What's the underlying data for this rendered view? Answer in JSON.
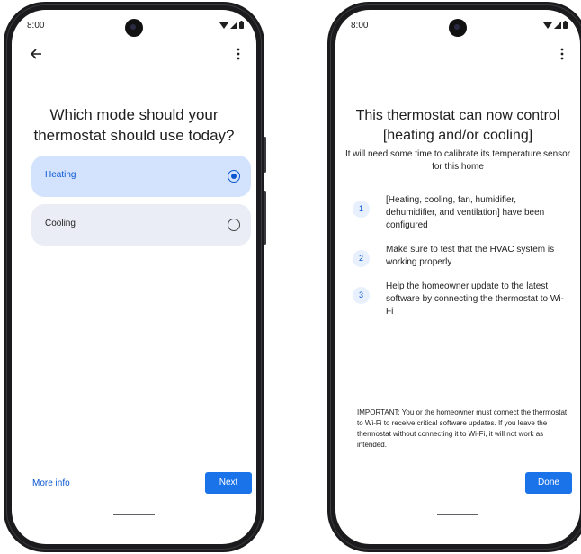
{
  "left": {
    "status": {
      "time": "8:00"
    },
    "title": "Which mode should your thermostat should use today?",
    "options": [
      {
        "label": "Heating",
        "selected": true
      },
      {
        "label": "Cooling",
        "selected": false
      }
    ],
    "more_info": "More info",
    "next": "Next"
  },
  "right": {
    "status": {
      "time": "8:00"
    },
    "title": "This thermostat can now control [heating and/or cooling]",
    "subtitle": "It will need some time to calibrate its temperature sensor for this home",
    "steps": [
      {
        "num": "1",
        "text": "[Heating, cooling, fan, humidifier, dehumidifier, and ventilation] have been configured"
      },
      {
        "num": "2",
        "text": "Make sure to test that the HVAC system is working properly"
      },
      {
        "num": "3",
        "text": "Help the homeowner update to the latest software by connecting the thermostat to Wi-Fi"
      }
    ],
    "important": "IMPORTANT: You or the homeowner must connect the thermostat to Wi-Fi to receive critical software updates. If you leave the thermostat without connecting it to Wi-Fi, it will not work as intended.",
    "done": "Done"
  },
  "colors": {
    "accent": "#1a73e8",
    "selected_bg": "#d3e3fd",
    "option_bg": "#eaedf5",
    "frame": "#1b1b1d"
  }
}
